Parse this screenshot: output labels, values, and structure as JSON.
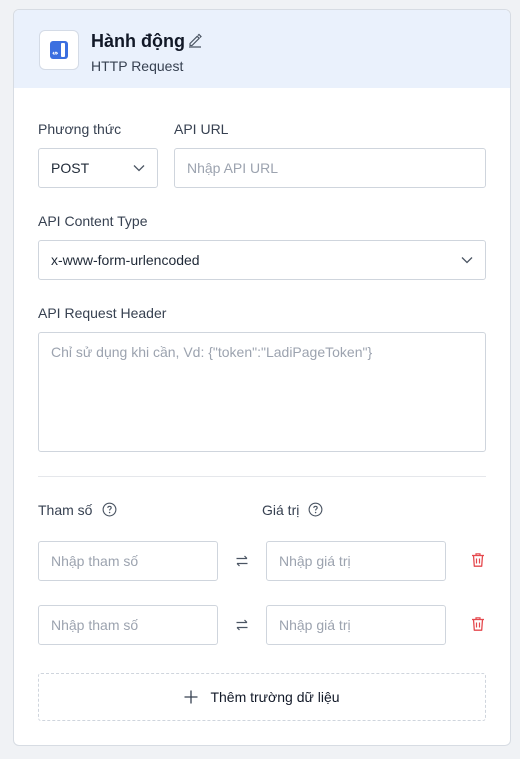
{
  "header": {
    "title": "Hành động",
    "subtitle": "HTTP Request",
    "icon": "http-request-icon",
    "edit_icon": "pencil-icon"
  },
  "method": {
    "label": "Phương thức",
    "value": "POST"
  },
  "api_url": {
    "label": "API URL",
    "placeholder": "Nhập API URL",
    "value": ""
  },
  "content_type": {
    "label": "API Content Type",
    "value": "x-www-form-urlencoded"
  },
  "request_header": {
    "label": "API Request Header",
    "placeholder": "Chỉ sử dụng khi cần, Vd: {\"token\":\"LadiPageToken\"}"
  },
  "params": {
    "key_label": "Tham số",
    "value_label": "Giá trị",
    "rows": [
      {
        "key_placeholder": "Nhập tham số",
        "value_placeholder": "Nhập giá trị"
      },
      {
        "key_placeholder": "Nhập tham số",
        "value_placeholder": "Nhập giá trị"
      }
    ]
  },
  "add_field_label": "Thêm trường dữ liệu",
  "colors": {
    "accent": "#3b6fe0",
    "header_bg": "#eaf1fc",
    "delete": "#e5484d"
  }
}
